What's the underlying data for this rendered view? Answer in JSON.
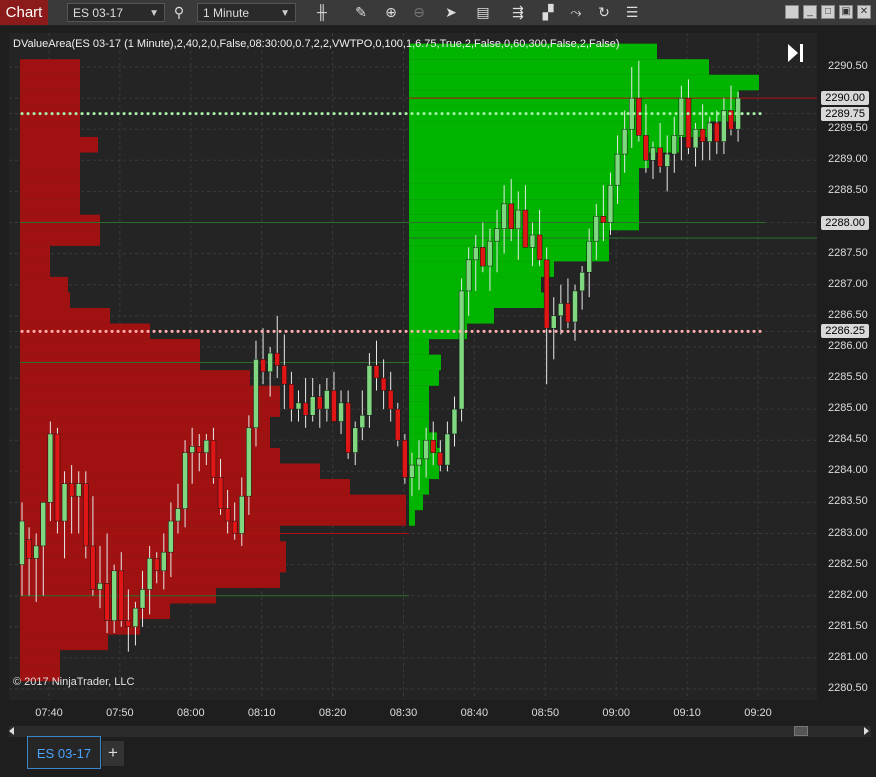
{
  "app": {
    "title": "Chart"
  },
  "toolbar": {
    "instrument": "ES 03-17",
    "interval": "1 Minute",
    "icons": [
      "search-icon",
      "candlestick-style-icon",
      "draw-pencil-icon",
      "zoom-in-icon",
      "zoom-out-icon",
      "pointer-icon",
      "data-box-icon",
      "bar-spacing-icon",
      "templates-icon",
      "strategies-icon",
      "refresh-icon",
      "properties-icon"
    ]
  },
  "window": {
    "buttons": [
      "workspace-icon",
      "minimize-icon",
      "maximize-icon",
      "close-icon"
    ]
  },
  "indicator": {
    "label": "DValueArea(ES 03-17 (1 Minute),2,40,2,0,False,08:30:00,0.7,2,2,VWTPO,0,100,1,6.75,True,2,False,0,60,300,False,2,False)"
  },
  "copyright": "© 2017 NinjaTrader, LLC",
  "price_axis": {
    "ticks": [
      "2290.50",
      "2290.00",
      "2289.75",
      "2289.50",
      "2289.00",
      "2288.50",
      "2288.00",
      "2287.50",
      "2287.00",
      "2286.50",
      "2286.25",
      "2286.00",
      "2285.50",
      "2285.00",
      "2284.50",
      "2284.00",
      "2283.50",
      "2283.00",
      "2282.50",
      "2282.00",
      "2281.50",
      "2281.00",
      "2280.50"
    ],
    "markers": [
      {
        "label": "2290.00",
        "bg": "#d8d8d8",
        "fg": "#000000"
      },
      {
        "label": "2289.75",
        "bg": "#d8d8d8",
        "fg": "#000000"
      },
      {
        "label": "2288.00",
        "bg": "#d8d8d8",
        "fg": "#000000"
      },
      {
        "label": "2286.25",
        "bg": "#d8d8d8",
        "fg": "#000000"
      }
    ]
  },
  "time_axis": {
    "ticks": [
      "07:40",
      "07:50",
      "08:00",
      "08:10",
      "08:20",
      "08:30",
      "08:40",
      "08:50",
      "09:00",
      "09:10",
      "09:20"
    ]
  },
  "colors": {
    "up": "#7fd87f",
    "down": "#e01515",
    "profile_red": "#a01212",
    "profile_green": "#00b400",
    "poc_left": "#ffb0b0",
    "poc_right": "#a8f0a8"
  },
  "tabs": [
    {
      "label": "ES 03-17",
      "active": true
    }
  ],
  "tab_add": "+"
}
